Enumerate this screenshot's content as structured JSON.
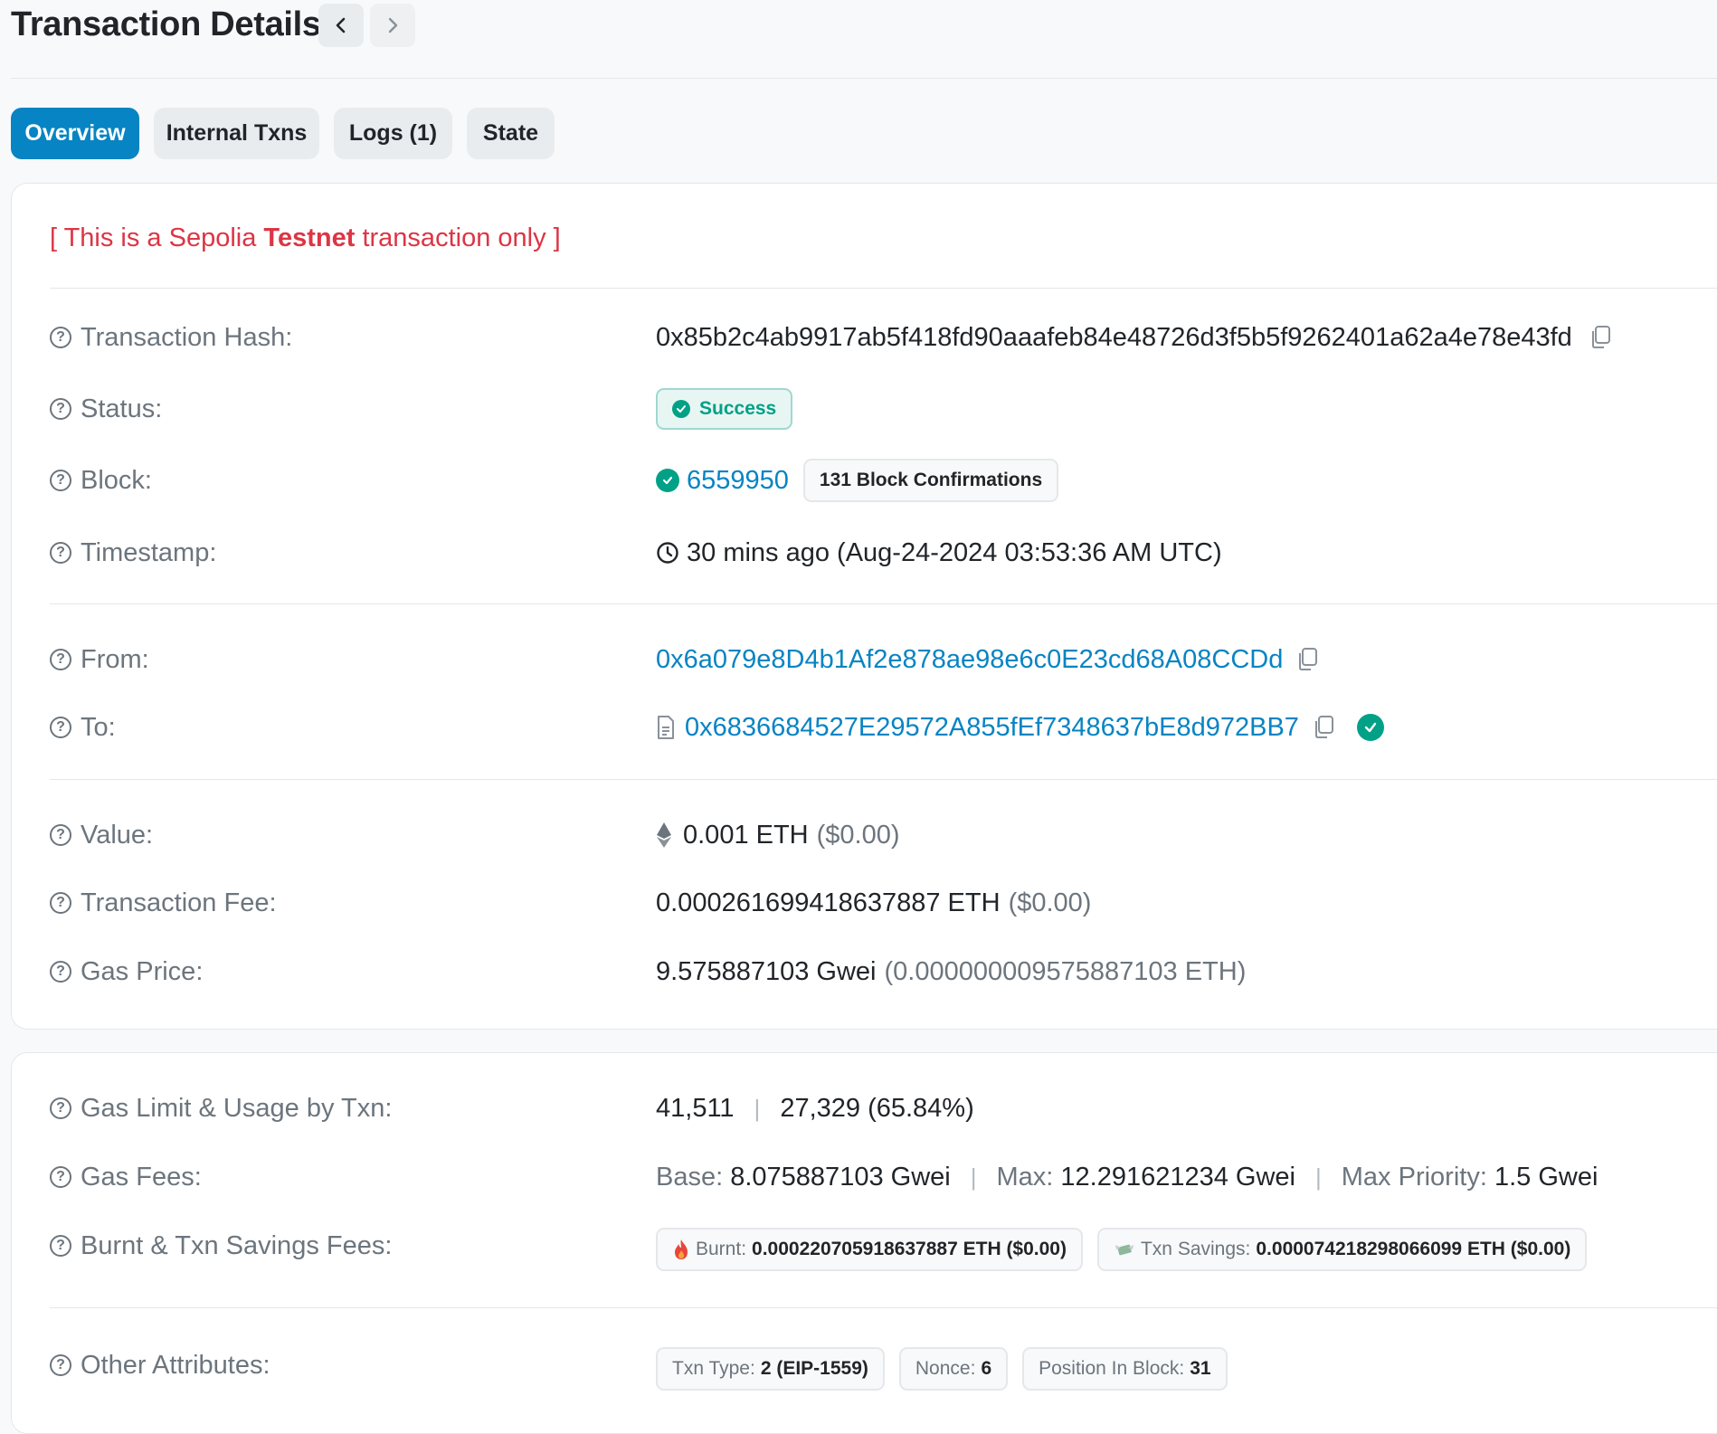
{
  "header": {
    "title": "Transaction Details",
    "prev_label": "‹",
    "next_label": "›"
  },
  "tabs": [
    {
      "label": "Overview",
      "active": true
    },
    {
      "label": "Internal Txns",
      "active": false
    },
    {
      "label": "Logs (1)",
      "active": false
    },
    {
      "label": "State",
      "active": false
    }
  ],
  "notice": {
    "open": "[ This is a Sepolia ",
    "bold": "Testnet",
    "close": " transaction only ]"
  },
  "fields": {
    "hash": {
      "label": "Transaction Hash:",
      "value": "0x85b2c4ab9917ab5f418fd90aaafeb84e48726d3f5b5f9262401a62a4e78e43fd"
    },
    "status": {
      "label": "Status:",
      "value": "Success"
    },
    "block": {
      "label": "Block:",
      "value": "6559950",
      "confirmations": "131 Block Confirmations"
    },
    "timestamp": {
      "label": "Timestamp:",
      "value": "30 mins ago (Aug-24-2024 03:53:36 AM UTC)"
    },
    "from": {
      "label": "From:",
      "value": "0x6a079e8D4b1Af2e878ae98e6c0E23cd68A08CCDd"
    },
    "to": {
      "label": "To:",
      "value": "0x6836684527E29572A855fEf7348637bE8d972BB7"
    },
    "value": {
      "label": "Value:",
      "amount": "0.001 ETH",
      "usd": "($0.00)"
    },
    "fee": {
      "label": "Transaction Fee:",
      "amount": "0.000261699418637887 ETH",
      "usd": "($0.00)"
    },
    "gas_price": {
      "label": "Gas Price:",
      "amount": "9.575887103 Gwei",
      "eth": "(0.000000009575887103 ETH)"
    },
    "gas_limit": {
      "label": "Gas Limit & Usage by Txn:",
      "limit": "41,511",
      "usage": "27,329 (65.84%)"
    },
    "gas_fees": {
      "label": "Gas Fees:",
      "base_key": "Base:",
      "base_val": "8.075887103 Gwei",
      "max_key": "Max:",
      "max_val": "12.291621234 Gwei",
      "prio_key": "Max Priority:",
      "prio_val": "1.5 Gwei"
    },
    "burnt": {
      "label": "Burnt & Txn Savings Fees:",
      "burnt_key": "Burnt:",
      "burnt_val": "0.000220705918637887 ETH ($0.00)",
      "savings_key": "Txn Savings:",
      "savings_val": "0.000074218298066099 ETH ($0.00)"
    },
    "other": {
      "label": "Other Attributes:",
      "type_key": "Txn Type:",
      "type_val": "2 (EIP-1559)",
      "nonce_key": "Nonce:",
      "nonce_val": "6",
      "pos_key": "Position In Block:",
      "pos_val": "31"
    }
  },
  "icons": {
    "help": "question-circle-icon",
    "copy": "copy-icon",
    "check": "check-circle-icon",
    "clock": "clock-icon",
    "contract": "file-contract-icon",
    "eth": "ethereum-icon",
    "fire": "fire-icon",
    "savings": "money-wings-icon"
  },
  "colors": {
    "accent": "#0784c3",
    "success": "#00a186",
    "danger": "#dc3545",
    "muted": "#6c757d"
  }
}
